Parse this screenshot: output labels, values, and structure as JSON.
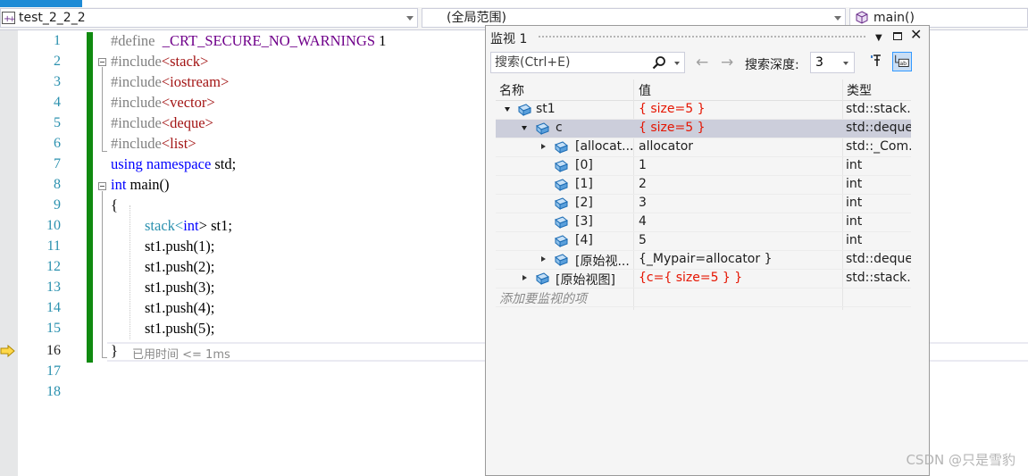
{
  "navbar": {
    "project": "test_2_2_2",
    "scope": "(全局范围)",
    "function": "main()"
  },
  "editor": {
    "line_numbers": [
      "1",
      "2",
      "3",
      "4",
      "5",
      "6",
      "7",
      "8",
      "9",
      "10",
      "11",
      "12",
      "13",
      "14",
      "15",
      "16",
      "17",
      "18"
    ],
    "current_line": "16",
    "lines": [
      {
        "a": "#define ",
        "b": " _CRT_SECURE_NO_WARNINGS",
        "c": " 1"
      },
      {
        "a": "#include",
        "b": "<stack>"
      },
      {
        "a": "#include",
        "b": "<iostream>"
      },
      {
        "a": "#include",
        "b": "<vector>"
      },
      {
        "a": "#include",
        "b": "<deque>"
      },
      {
        "a": "#include",
        "b": "<list>"
      },
      {
        "a": "using",
        "b": " ",
        "c": "namespace",
        "d": " std;"
      },
      {
        "a": "int",
        "b": " main()"
      },
      {
        "a": "{"
      },
      {
        "a": "stack",
        "b": "<",
        "c": "int",
        "d": "> st1;"
      },
      {
        "a": "st1.push(1);"
      },
      {
        "a": "st1.push(2);"
      },
      {
        "a": "st1.push(3);"
      },
      {
        "a": "st1.push(4);"
      },
      {
        "a": "st1.push(5);"
      },
      {
        "a": "}"
      }
    ],
    "elapsed": "已用时间 <= 1ms"
  },
  "watch": {
    "title": "监视 1",
    "search_placeholder": "搜索(Ctrl+E)",
    "depth_label": "搜索深度:",
    "depth_value": "3",
    "columns": {
      "name": "名称",
      "value": "值",
      "type": "类型"
    },
    "rows": [
      {
        "name": "st1",
        "value": "{ size=5 }",
        "type": "std::stack..."
      },
      {
        "name": "c",
        "value": "{ size=5 }",
        "type": "std::deque..."
      },
      {
        "name": "[allocat...",
        "value": "allocator",
        "type": "std::_Com..."
      },
      {
        "name": "[0]",
        "value": "1",
        "type": "int"
      },
      {
        "name": "[1]",
        "value": "2",
        "type": "int"
      },
      {
        "name": "[2]",
        "value": "3",
        "type": "int"
      },
      {
        "name": "[3]",
        "value": "4",
        "type": "int"
      },
      {
        "name": "[4]",
        "value": "5",
        "type": "int"
      },
      {
        "name": "[原始视...",
        "value": "{_Mypair=allocator }",
        "type": "std::deque..."
      },
      {
        "name": "[原始视图]",
        "value": "{c={ size=5 } }",
        "type": "std::stack..."
      }
    ],
    "add_placeholder": "添加要监视的项"
  },
  "watermark": "CSDN @只是雪豹"
}
